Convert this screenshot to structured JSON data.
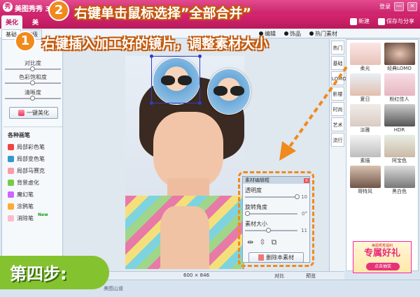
{
  "window": {
    "title": "美图秀秀 3.1",
    "login": "登录",
    "logo_letter": "秀",
    "minimize": "—",
    "close": "×"
  },
  "main_tabs": [
    "美化",
    "美"
  ],
  "top_buttons": {
    "new": "新建",
    "save_share": "保存与分享"
  },
  "subtabs": [
    "基础",
    "高级"
  ],
  "tools": [
    "编辑",
    "饰品",
    "热门素材"
  ],
  "left_panel": {
    "sliders": [
      "对比度",
      "色彩饱和度",
      "清晰度"
    ],
    "slider_levels": [
      0.5,
      0.5,
      0.5
    ],
    "one_click_button": "一键美化",
    "brush_title": "各种画笔",
    "brushes": [
      "局部彩色笔",
      "局部变色笔",
      "局部马赛克",
      "背景虚化",
      "魔幻笔",
      "涂鸦笔",
      "消除笔"
    ],
    "new_badge": "New"
  },
  "editor": {
    "title": "素材编辑框",
    "close": "×",
    "transparency_label": "透明度",
    "transparency_value": "10",
    "transparency_level": 1.0,
    "rotation_label": "旋转角度",
    "rotation_value": "0°",
    "rotation_level": 0.05,
    "size_label": "素材大小",
    "size_value": "11",
    "size_level": 0.45,
    "flip_h_icon": "⇹",
    "flip_v_icon": "⇳",
    "copy_icon": "⧉",
    "delete_button": "删除本素材"
  },
  "right_tabs": [
    "基础",
    "LOMO",
    "影楼",
    "时尚",
    "艺术",
    "流行"
  ],
  "right_top_tab": "热门",
  "effects": [
    "柔光",
    "经典LOMO",
    "夏日",
    "粉红佳人",
    "淡雅",
    "HDR",
    "素描",
    "阿宝色",
    "哥特风",
    "黑白色"
  ],
  "ad": {
    "small": "美图秀秀福利",
    "big": "专属好礼",
    "btn": "点击抽奖"
  },
  "status": {
    "dims": "600 × 846",
    "compare": "对比",
    "preview": "预览"
  },
  "bottom_link": "美图山道",
  "overlay": {
    "badge1": "1",
    "text1": "右键插入加工好的镜片，调整素材大小",
    "badge2": "2",
    "text2": "右键单击鼠标选择”全部合并”",
    "step": "第四步:"
  },
  "colors": {
    "accent": "#d6256f",
    "annotation": "#f08a1c",
    "step_green": "#84c32f"
  }
}
